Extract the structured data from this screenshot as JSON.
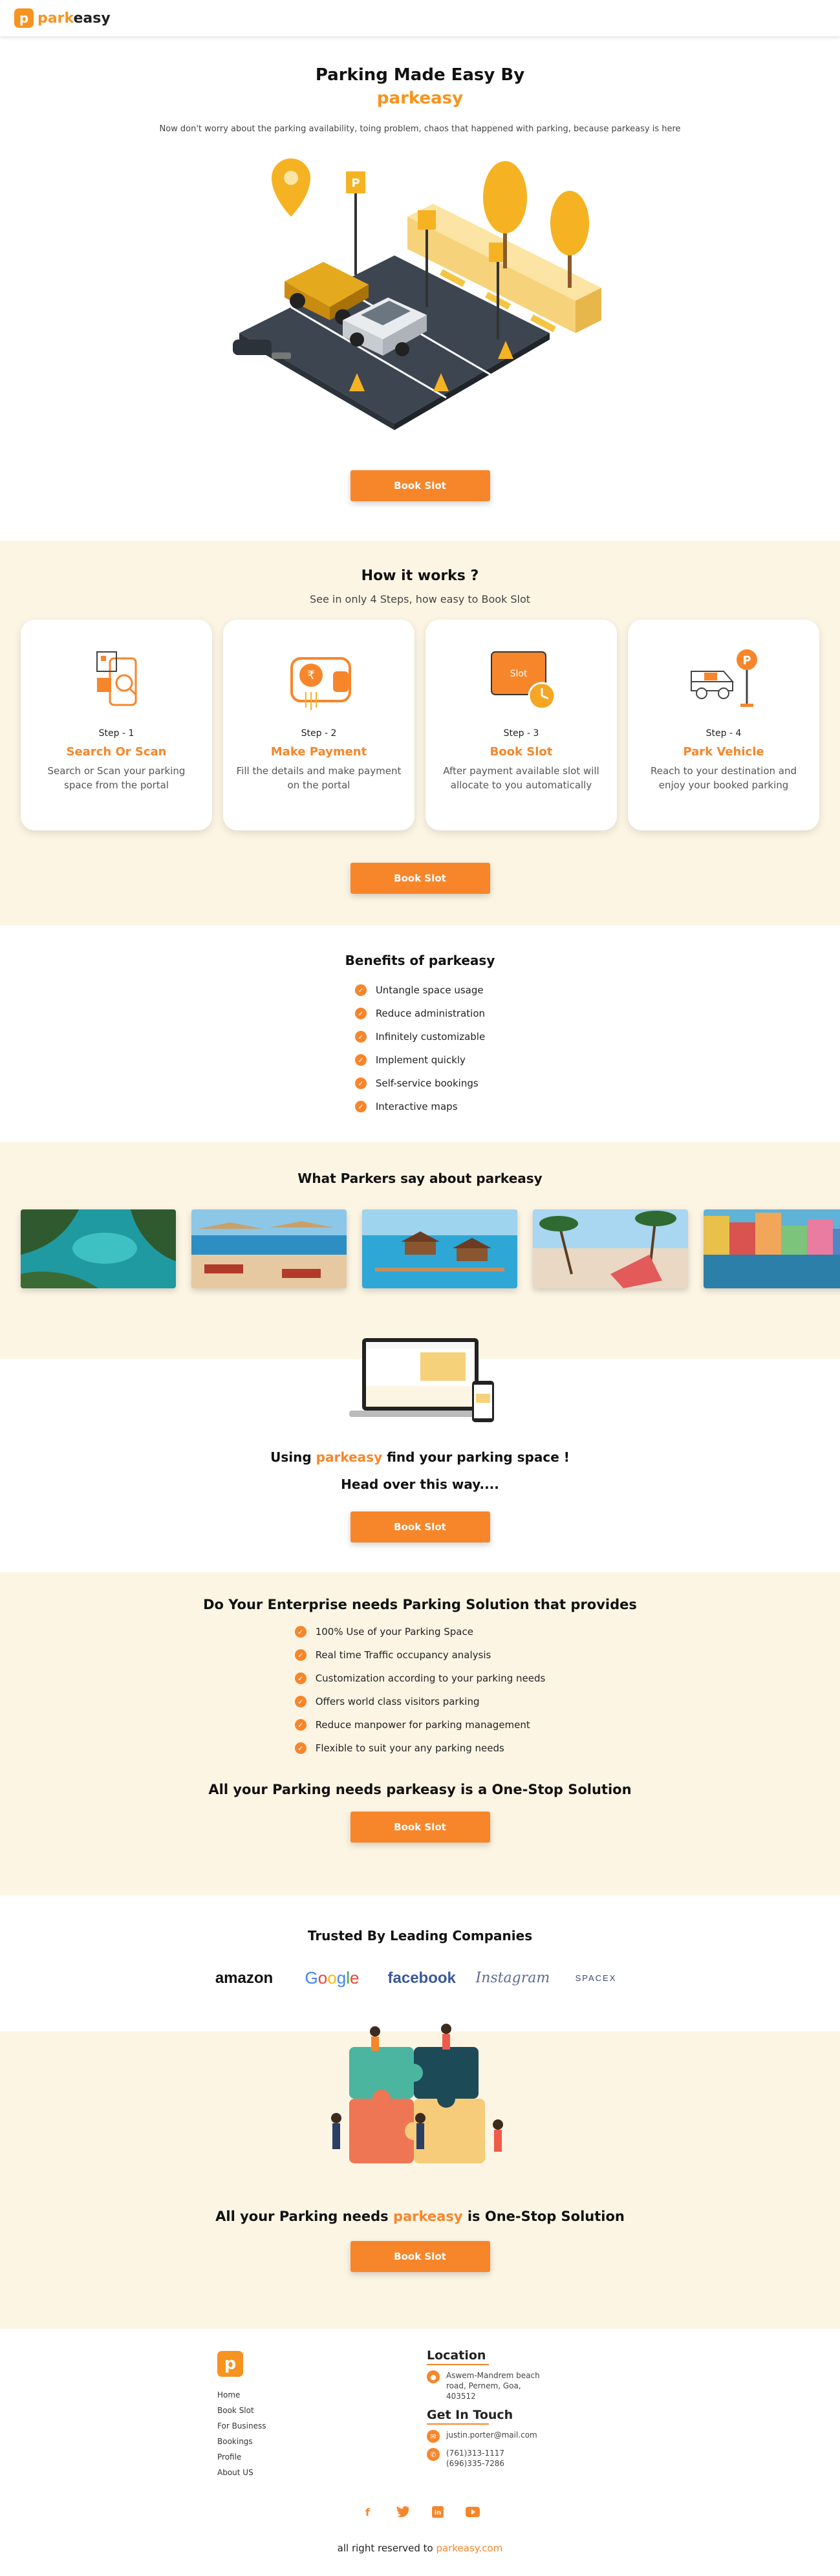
{
  "header": {
    "logo_letter": "p",
    "logo_brand_a": "park",
    "logo_brand_b": "easy"
  },
  "hero": {
    "title": "Parking Made Easy By",
    "brand": "parkeasy",
    "subtitle": "Now don't worry about the parking availability, toing problem, chaos that happened with parking, because parkeasy is here",
    "cta": "Book Slot"
  },
  "how": {
    "title": "How it works ?",
    "subtitle": "See in only 4 Steps, how easy to Book Slot",
    "steps": [
      {
        "num": "Step - 1",
        "title": "Search Or Scan",
        "desc": "Search or Scan your parking space from the portal",
        "icon": "scan-phone-icon"
      },
      {
        "num": "Step - 2",
        "title": "Make Payment",
        "desc": "Fill the details and make payment on the portal",
        "icon": "wallet-payment-icon"
      },
      {
        "num": "Step - 3",
        "title": "Book Slot",
        "desc": "After payment available slot will allocate to you automatically",
        "icon": "slot-clock-icon",
        "badge": "Slot"
      },
      {
        "num": "Step - 4",
        "title": "Park Vehicle",
        "desc": "Reach to your destination and enjoy your booked parking",
        "icon": "car-parking-icon",
        "badge": "P"
      }
    ],
    "cta": "Book Slot"
  },
  "benefits": {
    "title": "Benefits of parkeasy",
    "items": [
      "Untangle space usage",
      "Reduce administration",
      "Infinitely customizable",
      "Implement quickly",
      "Self-service bookings",
      "Interactive maps"
    ]
  },
  "parkers": {
    "title": "What Parkers say about parkeasy"
  },
  "using": {
    "line_a": "Using",
    "brand": "parkeasy",
    "line_b": "find your parking space !",
    "line2": "Head over this way....",
    "cta": "Book Slot"
  },
  "enterprise": {
    "title": "Do Your Enterprise needs Parking Solution that provides",
    "items": [
      "100% Use of your Parking Space",
      "Real time Traffic occupancy analysis",
      "Customization according to your parking needs",
      "Offers world class visitors parking",
      "Reduce manpower for parking management",
      "Flexible to suit your any parking needs"
    ],
    "tagline": "All your Parking needs parkeasy is a One-Stop Solution",
    "cta": "Book Slot"
  },
  "trusted": {
    "title": "Trusted By Leading Companies",
    "brands": [
      "amazon",
      "Google",
      "facebook",
      "Instagram",
      "SPACEX"
    ]
  },
  "puzzle": {
    "line_a": "All your Parking needs",
    "brand": "parkeasy",
    "line_b": "is One-Stop Solution",
    "cta": "Book Slot"
  },
  "footer": {
    "links": [
      "Home",
      "Book Slot",
      "For Business",
      "Bookings",
      "Profile",
      "About US"
    ],
    "location_title": "Location",
    "address": "Aswem-Mandrem beach road, Pernem, Goa, 403512",
    "contact_title": "Get In Touch",
    "email": "justin.porter@mail.com",
    "phone1": "(761)313-1117",
    "phone2": "(696)335-7286",
    "socials": [
      "facebook-icon",
      "twitter-icon",
      "linkedin-icon",
      "youtube-icon"
    ],
    "copyright_a": "all right reserved to",
    "copyright_brand": "parkeasy.com"
  },
  "colors": {
    "accent": "#f7862b",
    "cream": "#fdf5e4"
  }
}
